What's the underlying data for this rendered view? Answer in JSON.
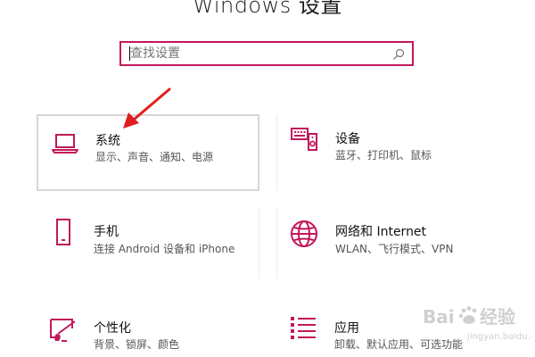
{
  "header": {
    "title": "Windows 设置"
  },
  "search": {
    "placeholder": "查找设置"
  },
  "colors": {
    "accent": "#c2185b",
    "annotation": "#e02020"
  },
  "tiles": [
    {
      "id": "system",
      "icon": "laptop-icon",
      "title": "系统",
      "desc": "显示、声音、通知、电源"
    },
    {
      "id": "devices",
      "icon": "keyboard-speaker-icon",
      "title": "设备",
      "desc": "蓝牙、打印机、鼠标"
    },
    {
      "id": "phone",
      "icon": "phone-icon",
      "title": "手机",
      "desc": "连接 Android 设备和 iPhone"
    },
    {
      "id": "network",
      "icon": "globe-icon",
      "title": "网络和 Internet",
      "desc": "WLAN、飞行模式、VPN"
    },
    {
      "id": "personalization",
      "icon": "paintbrush-icon",
      "title": "个性化",
      "desc": "背景、锁屏、颜色"
    },
    {
      "id": "apps",
      "icon": "apps-list-icon",
      "title": "应用",
      "desc": "卸载、默认应用、可选功能"
    }
  ]
}
